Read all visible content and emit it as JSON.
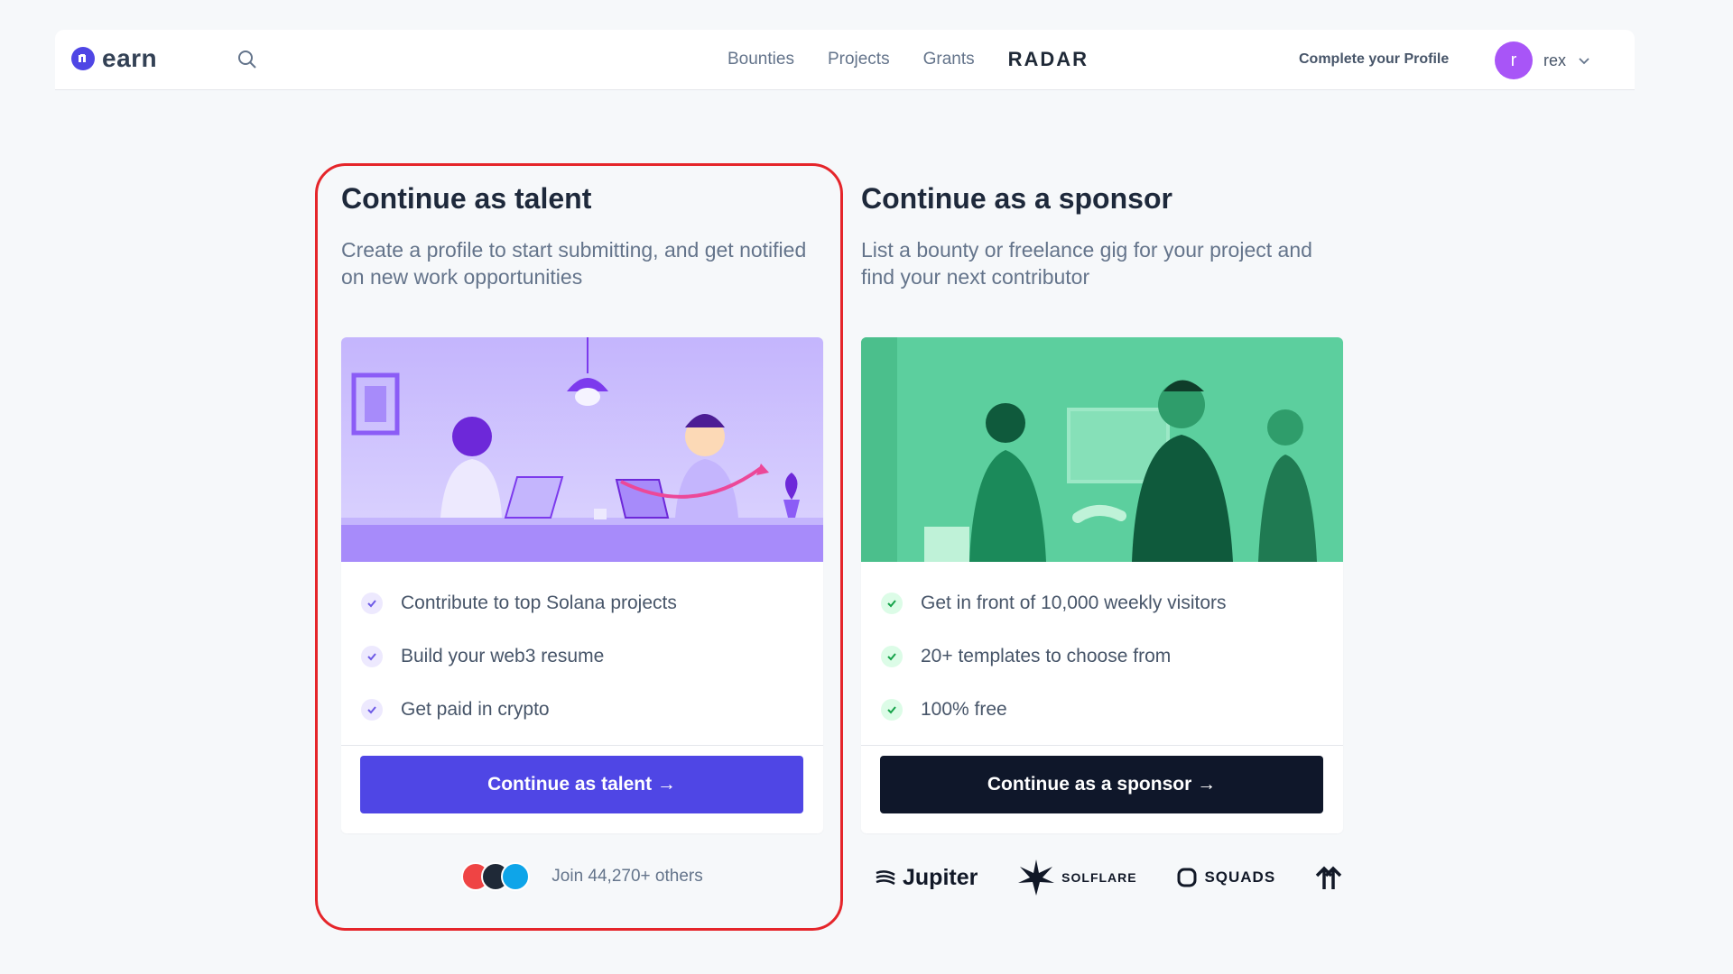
{
  "header": {
    "logo_text": "earn",
    "nav": [
      "Bounties",
      "Projects",
      "Grants"
    ],
    "radar": "RADAR",
    "complete_profile": "Complete your Profile",
    "user": {
      "initial": "r",
      "name": "rex"
    }
  },
  "talent": {
    "title": "Continue as talent",
    "subtitle": "Create a profile to start submitting, and get notified on new work opportunities",
    "benefits": [
      "Contribute to top Solana projects",
      "Build your web3 resume",
      "Get paid in crypto"
    ],
    "cta": "Continue as talent →",
    "join_text": "Join 44,270+ others",
    "accent": "#4f46e5"
  },
  "sponsor": {
    "title": "Continue as a sponsor",
    "subtitle": "List a bounty or freelance gig for your project and find your next contributor",
    "benefits": [
      "Get in front of 10,000 weekly visitors",
      "20+ templates to choose from",
      "100% free"
    ],
    "cta": "Continue as a sponsor →",
    "logos": [
      "Jupiter",
      "SOLFLARE",
      "SQUADS"
    ],
    "accent": "#0f172a"
  },
  "colors": {
    "highlight": "#e5252a",
    "talent_check": "#ede9fe",
    "sponsor_check": "#dcfce7"
  }
}
